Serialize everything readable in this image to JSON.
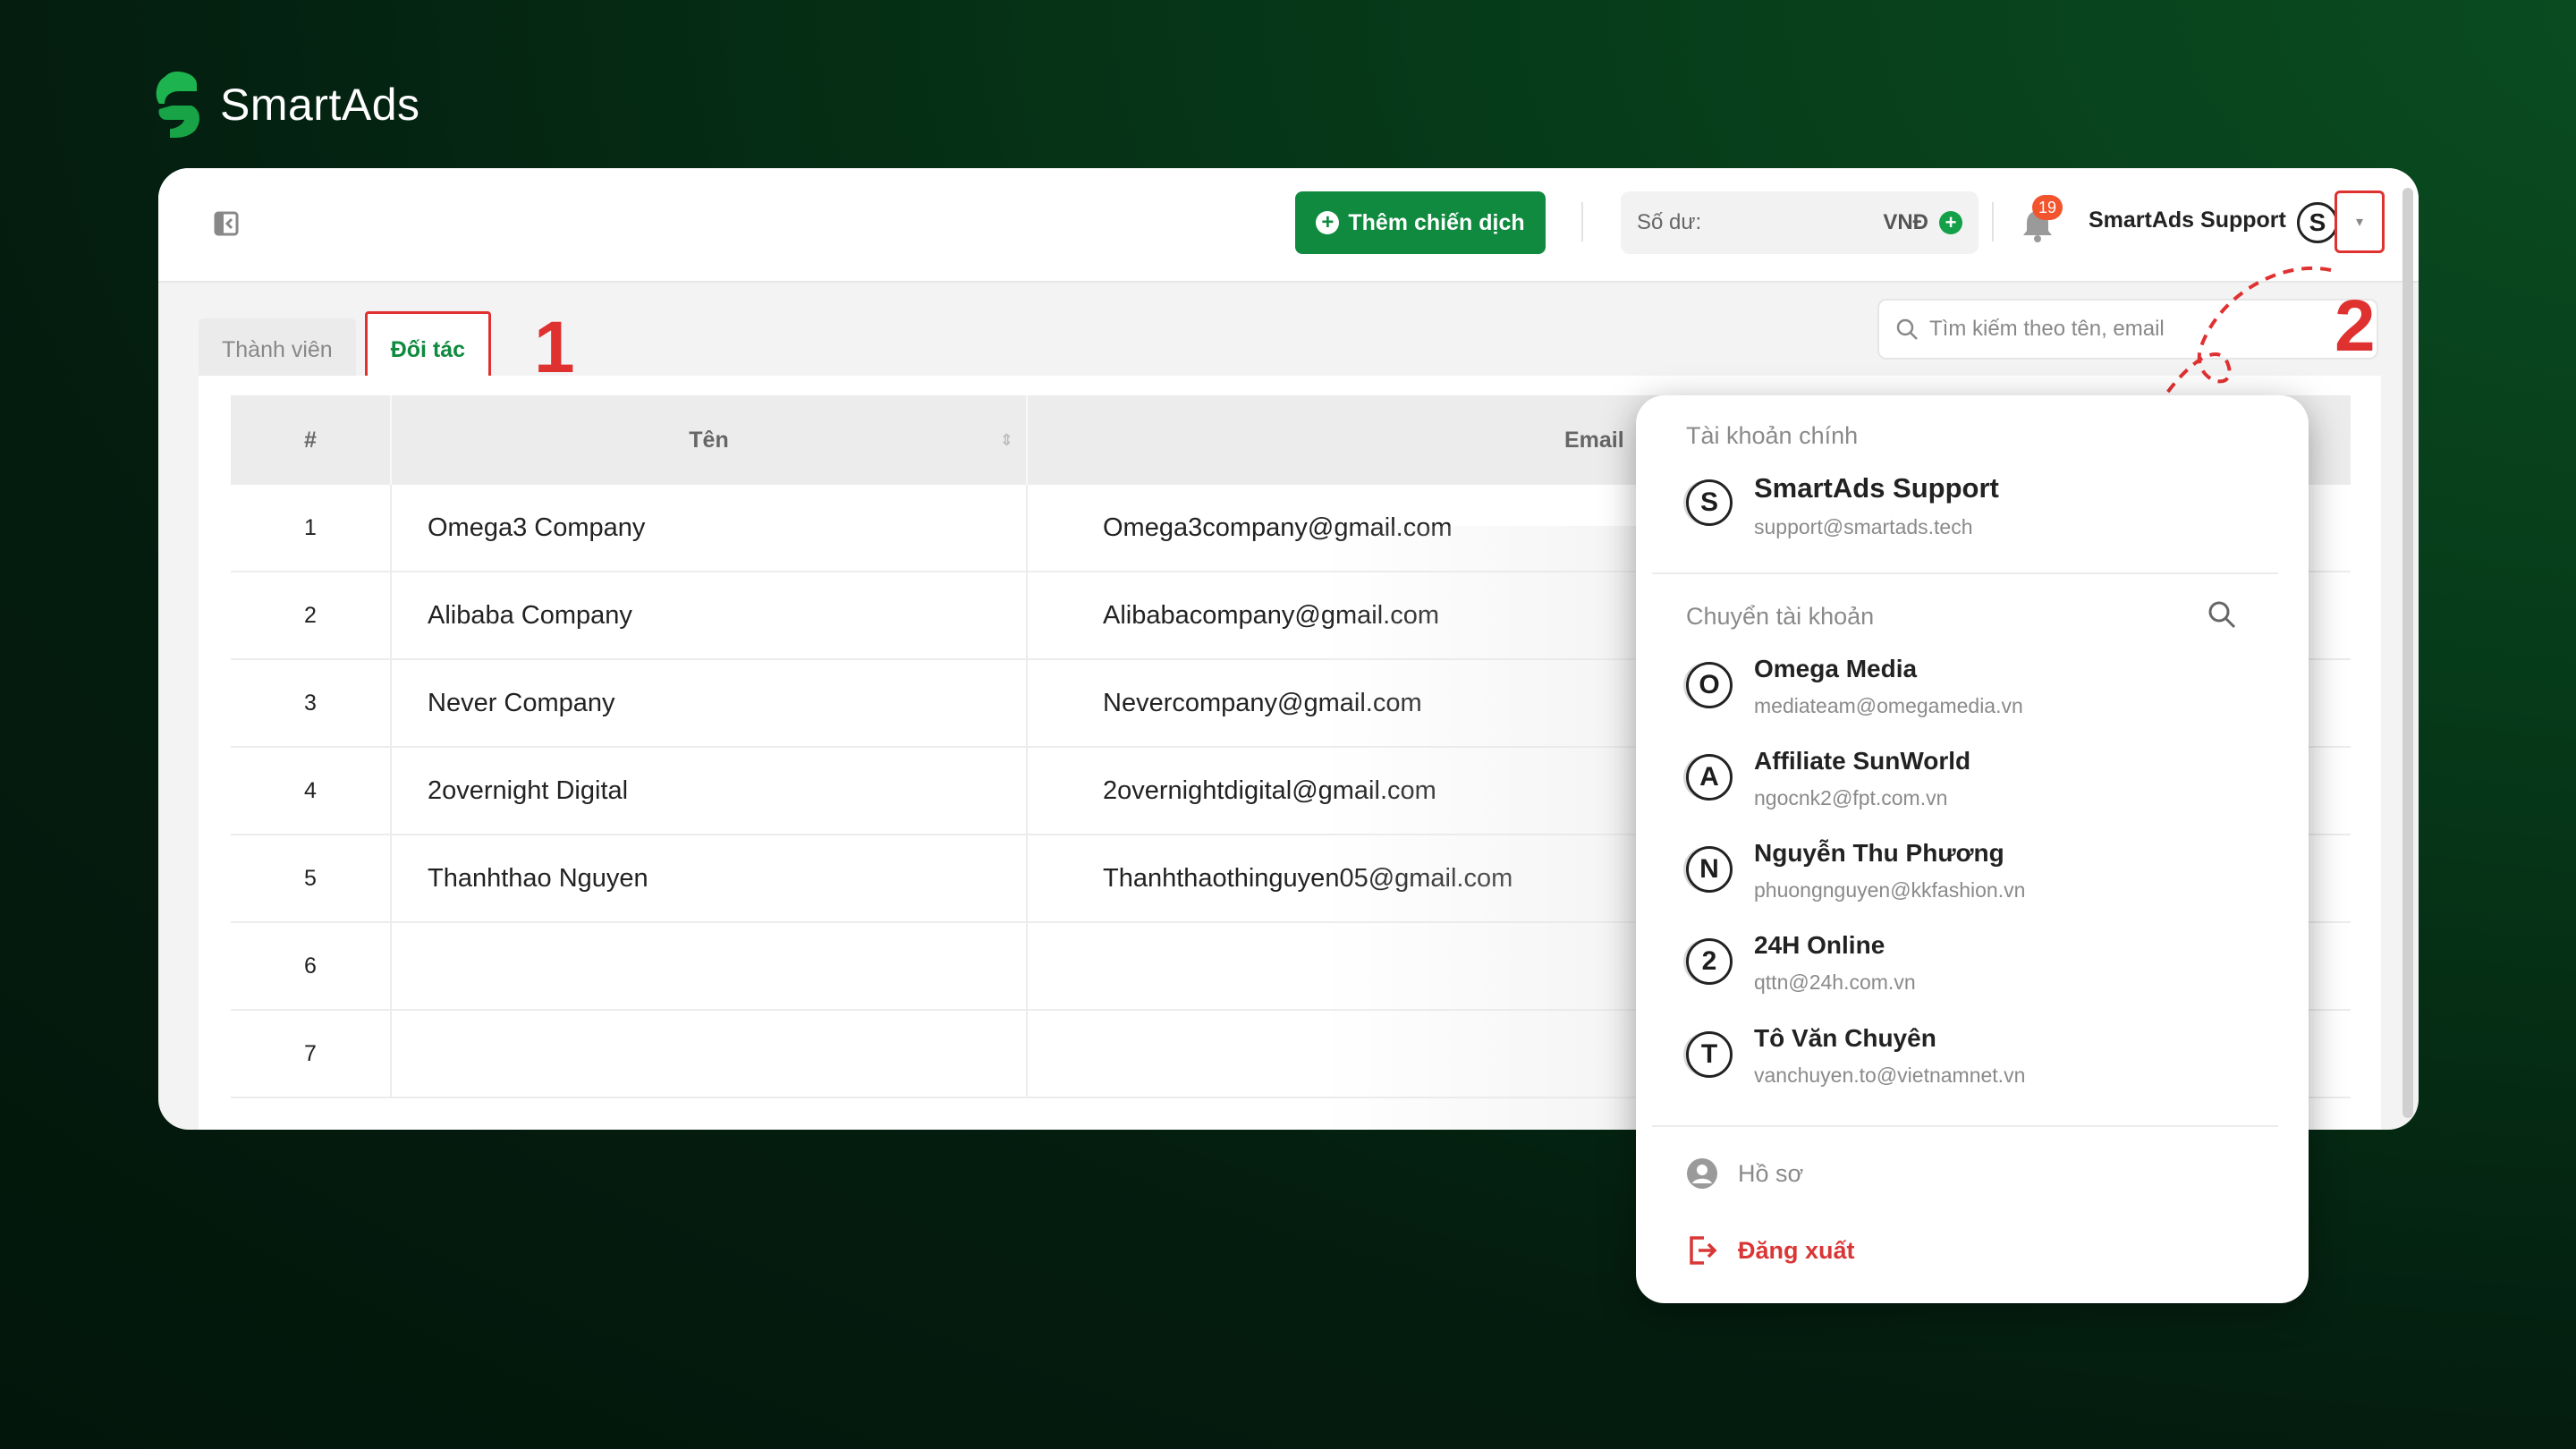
{
  "brand": {
    "name": "SmartAds"
  },
  "topbar": {
    "add_campaign": "Thêm chiến dịch",
    "balance_label": "Số dư:",
    "balance_currency": "VNĐ",
    "notification_count": "19",
    "user_name": "SmartAds Support",
    "user_initial": "S"
  },
  "tabs": [
    {
      "label": "Thành viên",
      "active": false
    },
    {
      "label": "Đối tác",
      "active": true
    }
  ],
  "annotations": {
    "step1": "1",
    "step2": "2",
    "highlight_color": "#e03131"
  },
  "search": {
    "placeholder": "Tìm kiếm theo tên, email"
  },
  "table": {
    "headers": {
      "index": "#",
      "name": "Tên",
      "email": "Email"
    },
    "rows": [
      {
        "index": "1",
        "name": "Omega3 Company",
        "email": "Omega3company@gmail.com"
      },
      {
        "index": "2",
        "name": "Alibaba Company",
        "email": "Alibabacompany@gmail.com"
      },
      {
        "index": "3",
        "name": "Never Company",
        "email": "Nevercompany@gmail.com"
      },
      {
        "index": "4",
        "name": "2overnight Digital",
        "email": "2overnightdigital@gmail.com"
      },
      {
        "index": "5",
        "name": "Thanhthao Nguyen",
        "email": "Thanhthaothinguyen05@gmail.com"
      },
      {
        "index": "6",
        "name": "",
        "email": ""
      },
      {
        "index": "7",
        "name": "",
        "email": ""
      }
    ]
  },
  "account_menu": {
    "main_title": "Tài khoản chính",
    "main_account": {
      "initial": "S",
      "name": "SmartAds Support",
      "email": "support@smartads.tech"
    },
    "switch_title": "Chuyển tài khoản",
    "accounts": [
      {
        "initial": "O",
        "name": "Omega Media",
        "email": "mediateam@omegamedia.vn"
      },
      {
        "initial": "A",
        "name": "Affiliate SunWorld",
        "email": "ngocnk2@fpt.com.vn"
      },
      {
        "initial": "N",
        "name": "Nguyễn Thu Phương",
        "email": "phuongnguyen@kkfashion.vn"
      },
      {
        "initial": "2",
        "name": "24H Online",
        "email": "qttn@24h.com.vn"
      },
      {
        "initial": "T",
        "name": "Tô Văn Chuyên",
        "email": "vanchuyen.to@vietnamnet.vn"
      }
    ],
    "profile": "Hồ sơ",
    "logout": "Đăng xuất"
  },
  "colors": {
    "brand_green": "#0f8a3e",
    "danger": "#d93636",
    "badge": "#f2542d"
  }
}
